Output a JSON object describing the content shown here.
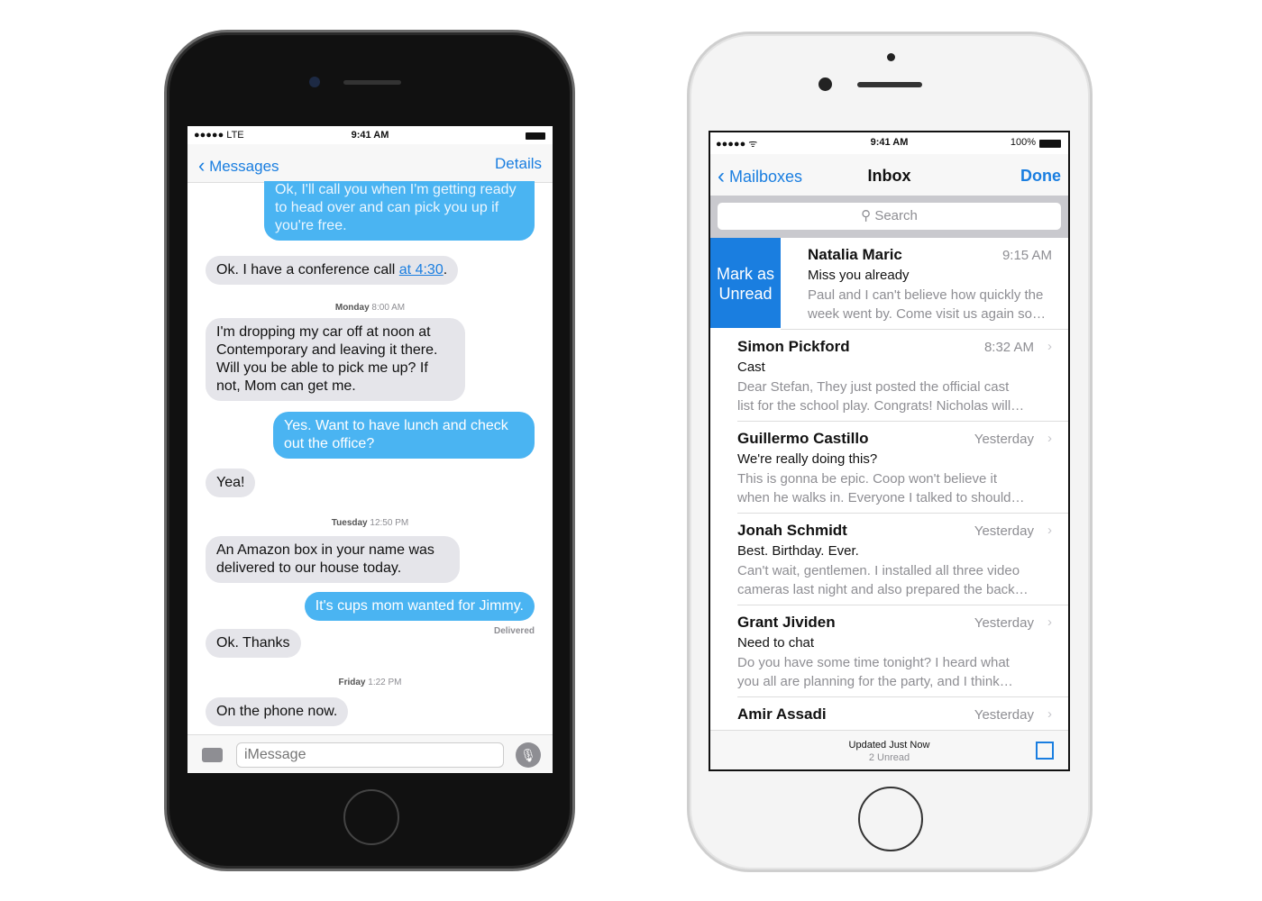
{
  "messages_app": {
    "status": {
      "signal": "●●●●● LTE",
      "time": "9:41 AM"
    },
    "nav": {
      "back": "Messages",
      "details": "Details"
    },
    "items": [
      {
        "kind": "out",
        "text": "Ok, I'll call you when I'm getting ready to head over and can pick you up if you're free."
      },
      {
        "kind": "in",
        "text": "Ok. I have a conference call ",
        "link": "at 4:30",
        "after": "."
      },
      {
        "kind": "ts",
        "day": "Monday",
        "time": "8:00 AM"
      },
      {
        "kind": "in",
        "text": "I'm dropping my car off at noon at Contemporary and leaving it there. Will you be able to pick me up? If not, Mom can get me."
      },
      {
        "kind": "out",
        "text": "Yes. Want to have lunch and check out the office?"
      },
      {
        "kind": "in",
        "text": "Yea!"
      },
      {
        "kind": "ts",
        "day": "Tuesday",
        "time": "12:50 PM"
      },
      {
        "kind": "in",
        "text": "An Amazon box in your name was delivered to our house today."
      },
      {
        "kind": "out",
        "text": "It's cups mom wanted for Jimmy."
      },
      {
        "kind": "delivered",
        "text": "Delivered"
      },
      {
        "kind": "in",
        "text": "Ok. Thanks"
      },
      {
        "kind": "ts",
        "day": "Friday",
        "time": "1:22 PM"
      },
      {
        "kind": "in",
        "text": "On the phone now."
      }
    ],
    "input": {
      "placeholder": "iMessage"
    }
  },
  "mail_app": {
    "status": {
      "signal": "●●●●●",
      "time": "9:41 AM",
      "battery": "100%"
    },
    "nav": {
      "back": "Mailboxes",
      "title": "Inbox",
      "done": "Done"
    },
    "search": {
      "placeholder": "Search"
    },
    "swipe_action": "Mark as Unread",
    "accent": "#1a7ee0",
    "emails": [
      {
        "sender": "Natalia Maric",
        "time": "9:15 AM",
        "subject": "Miss you already",
        "preview1": "Paul and I can't believe how quickly the",
        "preview2": "week went by. Come visit us again so…"
      },
      {
        "sender": "Simon Pickford",
        "time": "8:32 AM",
        "subject": "Cast",
        "preview1": "Dear Stefan, They just posted the official cast",
        "preview2": "list for the school play. Congrats! Nicholas will…"
      },
      {
        "sender": "Guillermo Castillo",
        "time": "Yesterday",
        "subject": "We're really doing this?",
        "preview1": "This is gonna be epic. Coop won't believe it",
        "preview2": "when he walks in. Everyone I talked to should…"
      },
      {
        "sender": "Jonah Schmidt",
        "time": "Yesterday",
        "subject": "Best. Birthday. Ever.",
        "preview1": "Can't wait, gentlemen. I installed all three video",
        "preview2": "cameras last night and also prepared the back…"
      },
      {
        "sender": "Grant Jividen",
        "time": "Yesterday",
        "subject": "Need to chat",
        "preview1": "Do you have some time tonight? I heard what",
        "preview2": "you all are planning for the party, and I think…"
      },
      {
        "sender": "Amir Assadi",
        "time": "Yesterday",
        "subject": "",
        "preview1": "",
        "preview2": ""
      }
    ],
    "toolbar": {
      "updated": "Updated Just Now",
      "unread": "2 Unread"
    }
  }
}
